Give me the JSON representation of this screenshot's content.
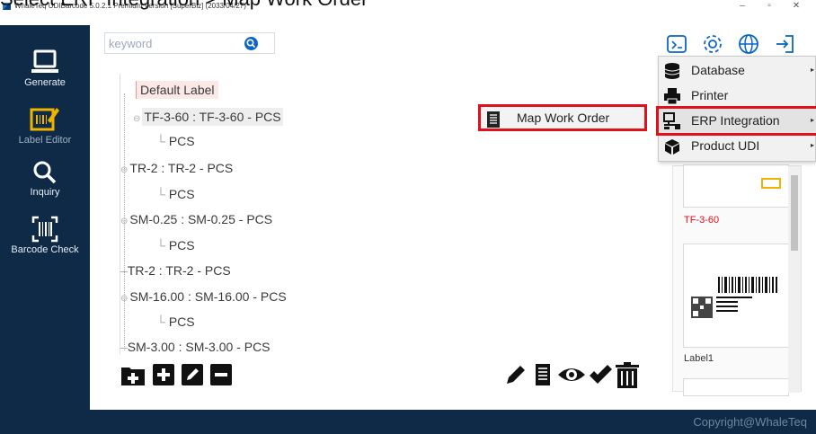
{
  "caption": "Select ERP Integration > Map Work Order",
  "window": {
    "title": "WhaleTeq UDIBarcode 5.0.2.1 Premium Version [SuperBiz] (2033/04/27)",
    "minimize": "–",
    "maximize": "▫",
    "close": "✕"
  },
  "sidebar": {
    "items": [
      {
        "label": "Generate",
        "icon": "laptop-icon"
      },
      {
        "label": "Label Editor",
        "icon": "label-edit-icon"
      },
      {
        "label": "Inquiry",
        "icon": "magnifier-icon"
      },
      {
        "label": "Barcode Check",
        "icon": "barcode-scan-icon"
      }
    ]
  },
  "search": {
    "placeholder": "keyword"
  },
  "tree": {
    "root": "Default Label",
    "rows": [
      {
        "text": "TF-3-60 : TF-3-60 - PCS"
      },
      {
        "text": "PCS"
      },
      {
        "text": "TR-2 : TR-2 - PCS"
      },
      {
        "text": "PCS"
      },
      {
        "text": "SM-0.25 : SM-0.25 - PCS"
      },
      {
        "text": "PCS"
      },
      {
        "text": "TR-2 : TR-2 - PCS"
      },
      {
        "text": "SM-16.00 : SM-16.00 - PCS"
      },
      {
        "text": "PCS"
      },
      {
        "text": "SM-3.00 : SM-3.00 - PCS"
      }
    ]
  },
  "submenu": {
    "label": "Map Work Order"
  },
  "dropdown": {
    "items": [
      {
        "label": "Database",
        "icon": "database-icon"
      },
      {
        "label": "Printer",
        "icon": "printer-icon"
      },
      {
        "label": "ERP Integration",
        "icon": "network-icon"
      },
      {
        "label": "Product UDI",
        "icon": "box-icon"
      }
    ],
    "arrow": "▸"
  },
  "thumbnails": {
    "items": [
      {
        "label": "TF-3-60"
      },
      {
        "label": "Label1"
      }
    ]
  },
  "footer": {
    "copyright": "Copyright@WhaleTeq"
  },
  "colors": {
    "sidebar": "#0e2a47",
    "highlight": "#e0101c",
    "accent": "#0a66c2"
  }
}
